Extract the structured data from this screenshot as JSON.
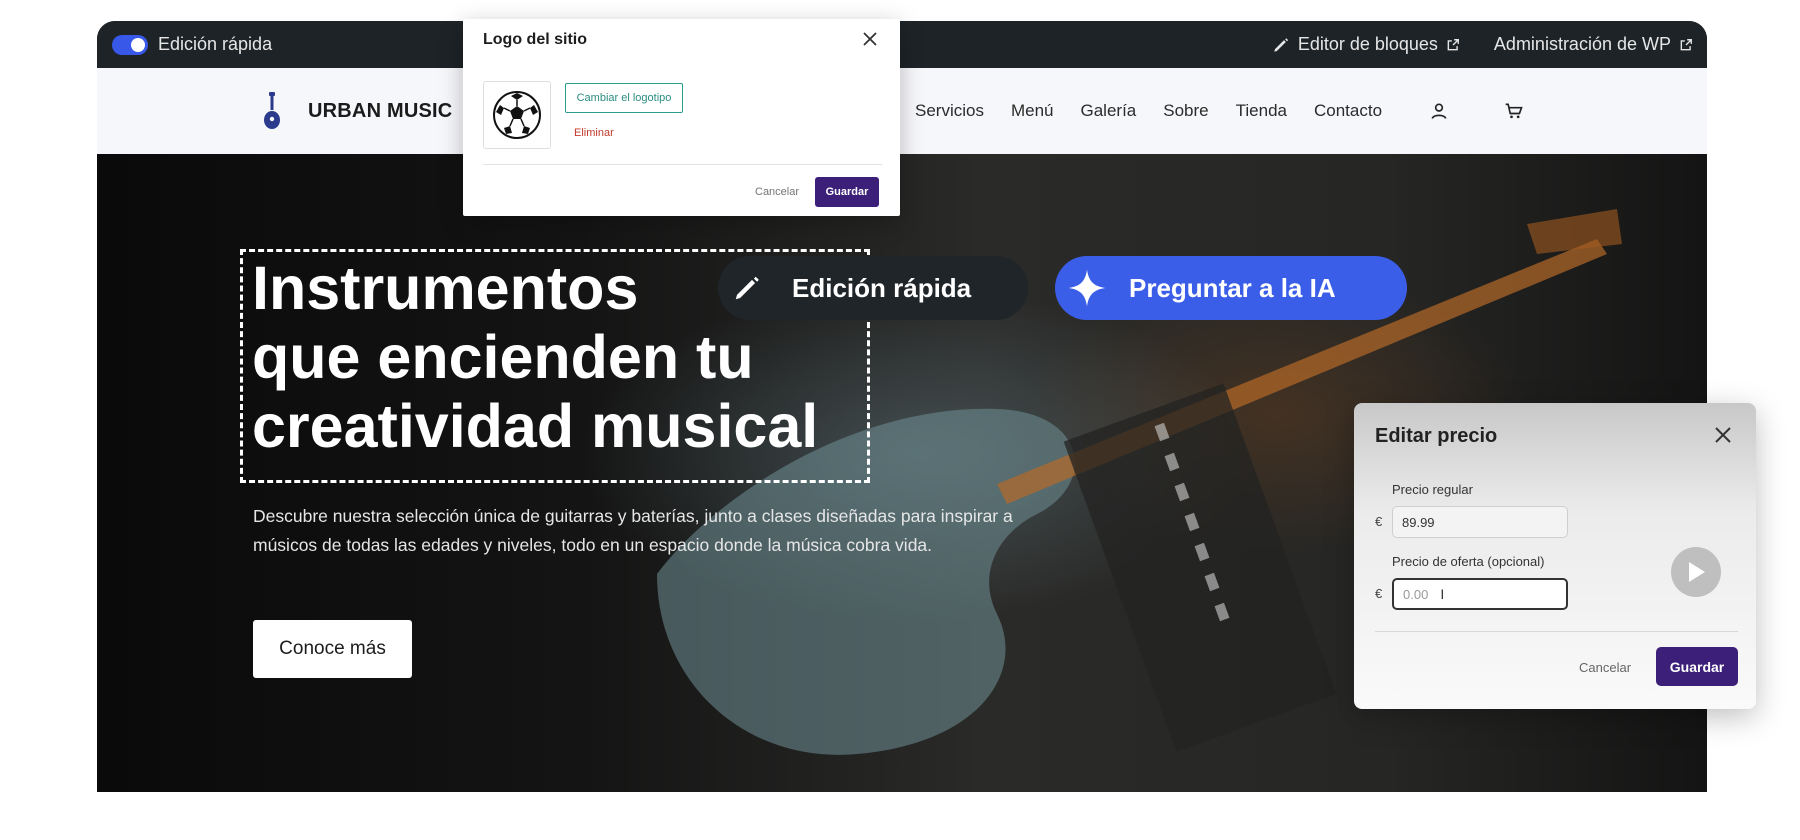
{
  "admin_bar": {
    "quick_edit_label": "Edición rápida",
    "block_editor_label": "Editor de bloques",
    "wp_admin_label": "Administración de WP"
  },
  "site_header": {
    "site_name": "URBAN MUSIC",
    "nav_items": [
      "Servicios",
      "Menú",
      "Galería",
      "Sobre",
      "Tienda",
      "Contacto"
    ]
  },
  "hero": {
    "headline_lines": [
      "Instrumentos",
      "que encienden tu",
      "creatividad musical"
    ],
    "description": "Descubre nuestra selección única de guitarras y baterías, junto a clases diseñadas para inspirar a músicos de todas las edades y niveles, todo en un espacio donde la música cobra vida.",
    "cta_label": "Conoce más"
  },
  "badges": {
    "quick_edit": "Edición rápida",
    "ask_ai": "Preguntar a la IA"
  },
  "logo_popover": {
    "title": "Logo del sitio",
    "change_label": "Cambiar el logotipo",
    "remove_label": "Eliminar",
    "cancel_label": "Cancelar",
    "save_label": "Guardar"
  },
  "price_popover": {
    "title": "Editar precio",
    "regular_label": "Precio regular",
    "currency": "€",
    "regular_value": "89.99",
    "sale_label": "Precio de oferta (opcional)",
    "sale_placeholder": "0.00",
    "cancel_label": "Cancelar",
    "save_label": "Guardar"
  },
  "colors": {
    "admin_bar_bg": "#1d2327",
    "toggle_accent": "#3858e9",
    "ai_pill": "#3a5ee8",
    "primary_button": "#3b1f78"
  }
}
